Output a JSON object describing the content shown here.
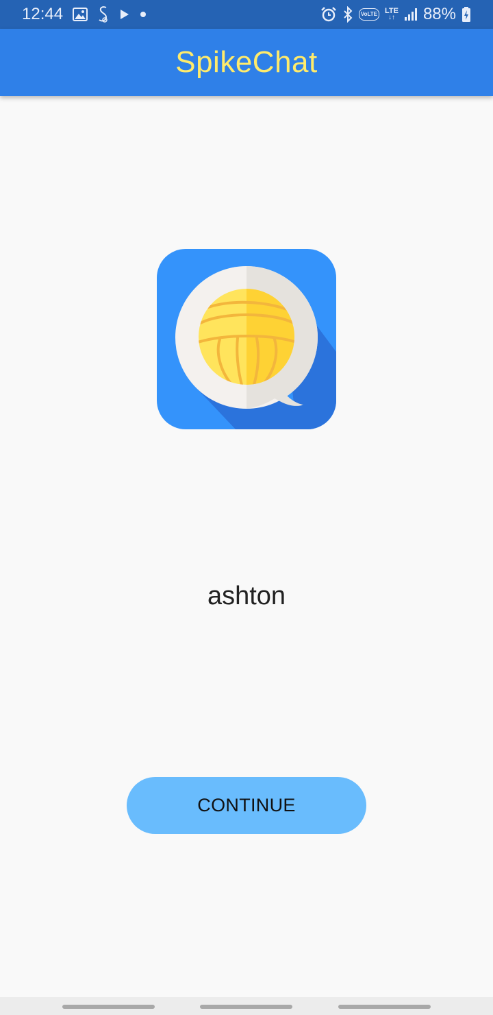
{
  "status_bar": {
    "time": "12:44",
    "volte": "VoLTE",
    "lte": "LTE",
    "battery": "88%"
  },
  "app_bar": {
    "title": "SpikeChat"
  },
  "main": {
    "username": "ashton",
    "continue_label": "CONTINUE"
  },
  "colors": {
    "status_bar": "#2563b4",
    "app_bar": "#2f80e8",
    "title": "#ffeb6b",
    "button": "#69bcfd",
    "background": "#f9f9f9"
  },
  "icons": [
    "gallery-icon",
    "samsung-health-icon",
    "play-icon",
    "dot-icon",
    "alarm-icon",
    "bluetooth-icon",
    "signal-icon",
    "battery-charging-icon",
    "app-logo-icon",
    "volleyball-icon"
  ]
}
